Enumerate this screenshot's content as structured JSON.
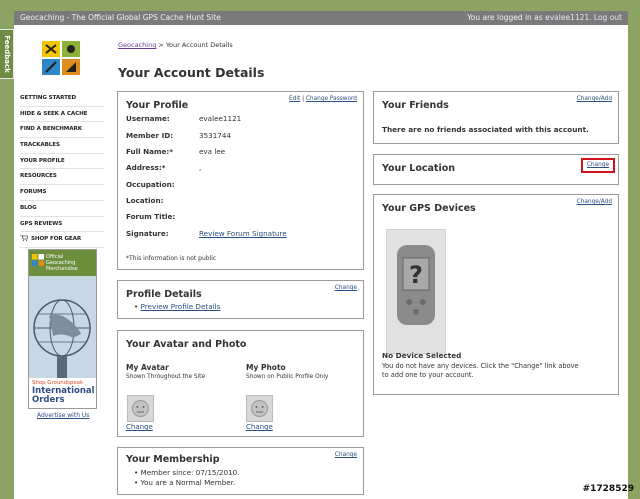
{
  "topbar": {
    "site_title": "Geocaching - The Official Global GPS Cache Hunt Site",
    "logged_in_prefix": "You are logged in as",
    "username": "evalee1121.",
    "logout": "Log out"
  },
  "feedback_tab": "Feedback",
  "sidebar": {
    "items": [
      "GETTING STARTED",
      "HIDE & SEEK A CACHE",
      "FIND A BENCHMARK",
      "TRACKABLES",
      "YOUR PROFILE",
      "RESOURCES",
      "FORUMS",
      "BLOG",
      "GPS REVIEWS",
      "SHOP FOR GEAR"
    ],
    "banner": {
      "head_line1": "Official",
      "head_line2": "Geocaching",
      "head_line3": "Merchandise",
      "shop": "Shop Groundspeak",
      "intl_line1": "International",
      "intl_line2": "Orders"
    },
    "ad_link": "Advertise with Us"
  },
  "breadcrumb": {
    "link": "Geocaching",
    "separator": ">",
    "current": "Your Account Details"
  },
  "page_title": "Your Account Details",
  "profile": {
    "title": "Your Profile",
    "edit_link": "Edit",
    "sep": "|",
    "change_password_link": "Change Password",
    "rows": [
      {
        "label": "Username:",
        "value": "evalee1121"
      },
      {
        "label": "Member ID:",
        "value": "3531744"
      },
      {
        "label": "Full Name:*",
        "value": "eva lee"
      },
      {
        "label": "Address:*",
        "value": ","
      },
      {
        "label": "Occupation:",
        "value": ""
      },
      {
        "label": "Location:",
        "value": ""
      },
      {
        "label": "Forum Title:",
        "value": ""
      }
    ],
    "signature_label": "Signature:",
    "signature_link": "Review Forum Signature",
    "note": "*This information is not public"
  },
  "profile_details": {
    "title": "Profile Details",
    "change_link": "Change",
    "bullet_link": "Preview Profile Details"
  },
  "avatar": {
    "title": "Your Avatar and Photo",
    "avatar_heading": "My Avatar",
    "avatar_sub": "Shown Throughout the Site",
    "avatar_change": "Change",
    "photo_heading": "My Photo",
    "photo_sub": "Shown on Public Profile Only",
    "photo_change": "Change"
  },
  "membership": {
    "title": "Your Membership",
    "change_link": "Change",
    "items": [
      "Member since: 07/15/2010.",
      "You are a Normal Member."
    ]
  },
  "friends": {
    "title": "Your Friends",
    "change_link": "Change/Add",
    "empty_text": "There are no friends associated with this account."
  },
  "location": {
    "title": "Your Location",
    "change_link": "Change"
  },
  "gps": {
    "title": "Your GPS Devices",
    "change_link": "Change/Add",
    "no_device_title": "No Device Selected",
    "no_device_text_1": "You do not have any devices. Click the \"Change\" link above",
    "no_device_text_2": "to add one to your account."
  },
  "watermark": "#1728529",
  "colors": {
    "page_bg": "#8da363",
    "topbar": "#7a7a7a",
    "link": "#2a4f82",
    "highlight": "#d0141c"
  }
}
